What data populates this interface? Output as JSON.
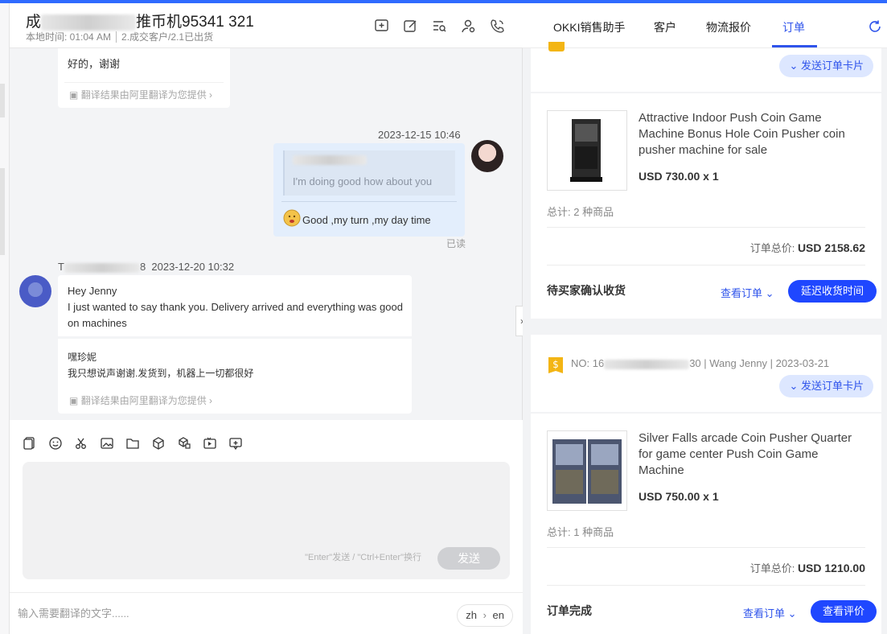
{
  "chat": {
    "title_prefix": "成",
    "title_suffix": "推币机95341 321",
    "local_time": "本地时间: 01:04 AM",
    "customer_info": "2.成交客户/2.1已出货",
    "messages": {
      "m1_text": "好的，谢谢",
      "m1_translation_note": "翻译结果由阿里翻译为您提供",
      "m2_timestamp": "2023-12-15 10:46",
      "m2_quote": "I'm doing good how about you",
      "m2_text": "Good ,my turn ,my day time",
      "m2_status": "已读",
      "m3_sender_prefix": "T",
      "m3_sender_suffix": "8",
      "m3_timestamp": "2023-12-20 10:32",
      "m3_line1": "Hey Jenny",
      "m3_line2": "I just wanted to say thank you. Delivery arrived and everything was good on machines",
      "m3_translation_line1": "嘿珍妮",
      "m3_translation_line2": "我只想说声谢谢.发货到，机器上一切都很好",
      "m3_translation_note": "翻译结果由阿里翻译为您提供"
    },
    "compose": {
      "hint": "\"Enter\"发送 / \"Ctrl+Enter\"换行",
      "send_label": "发送"
    },
    "translate_bar": {
      "placeholder": "输入需要翻译的文字......",
      "lang_from": "zh",
      "lang_to": "en"
    }
  },
  "tabs": [
    {
      "label": "OKKI销售助手"
    },
    {
      "label": "客户"
    },
    {
      "label": "物流报价"
    },
    {
      "label": "订单"
    }
  ],
  "orders": [
    {
      "send_card_label": "发送订单卡片",
      "product_name": "Attractive Indoor Push Coin Game Machine Bonus Hole Coin Pusher coin pusher machine for sale",
      "product_price": "USD 730.00 x 1",
      "summary": "总计: 2 种商品",
      "total_label": "订单总价:",
      "total_value": "USD 2158.62",
      "status": "待买家确认收货",
      "view_label": "查看订单",
      "action_label": "延迟收货时间"
    },
    {
      "order_no_prefix": "NO: 16",
      "order_no_suffix": "30",
      "order_meta": "| Wang Jenny | 2023-03-21",
      "send_card_label": "发送订单卡片",
      "product_name": "Silver Falls arcade Coin Pusher Quarter for game center Push Coin Game Machine",
      "product_price": "USD 750.00 x 1",
      "summary": "总计: 1 种商品",
      "total_label": "订单总价:",
      "total_value": "USD 1210.00",
      "status": "订单完成",
      "view_label": "查看订单",
      "action_label": "查看评价"
    }
  ],
  "colors": {
    "accent": "#2f54eb",
    "primary_button": "#1f47ff",
    "send_card_bg": "#dde7ff",
    "chat_bg": "#f3f4f6",
    "own_bubble": "#e3eefc"
  }
}
